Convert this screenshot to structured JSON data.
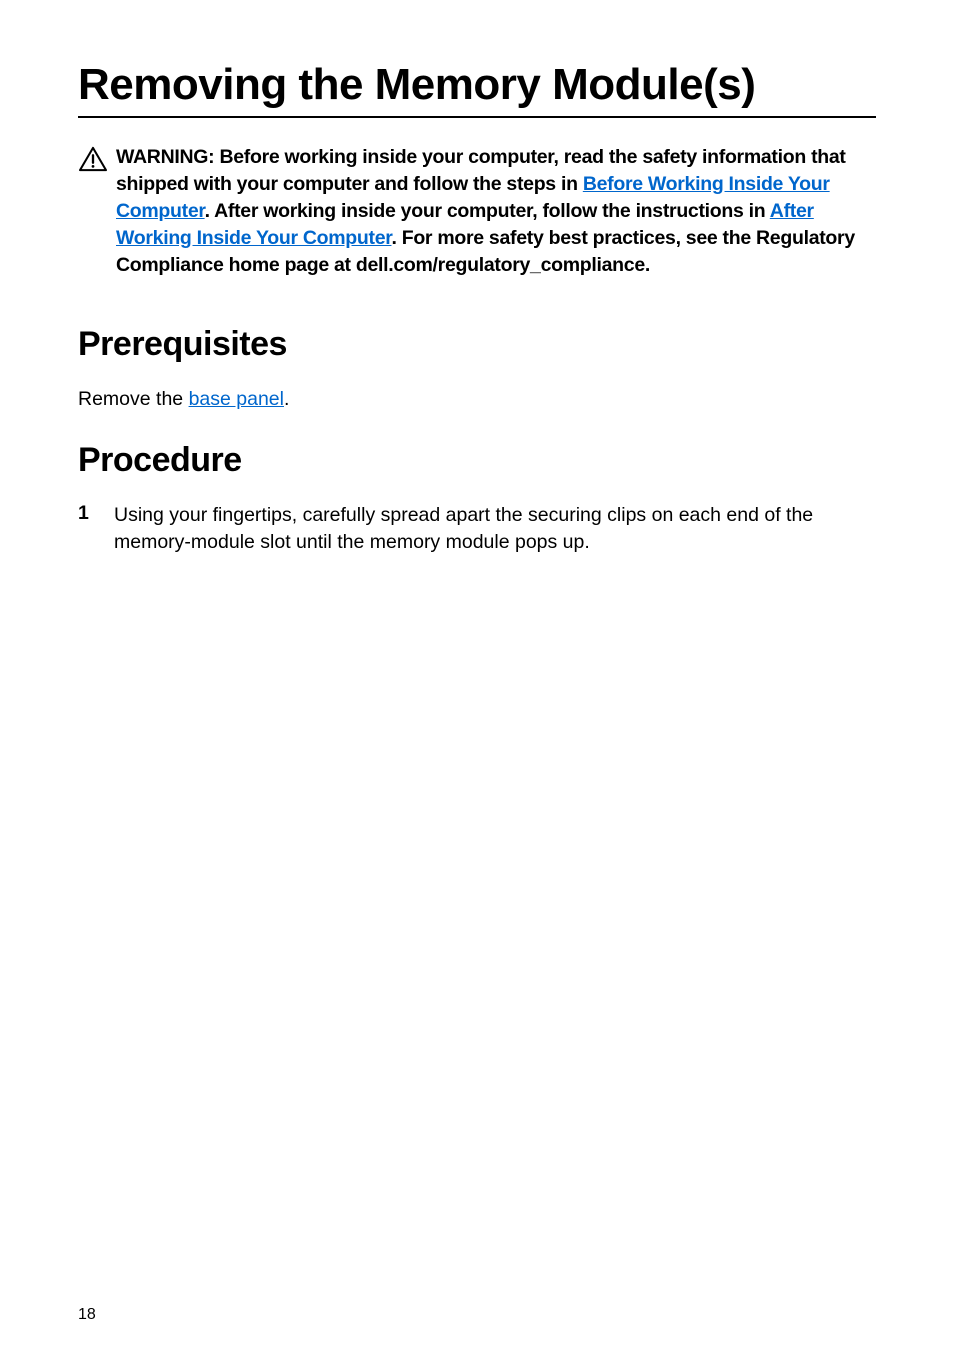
{
  "title": "Removing the Memory Module(s)",
  "warning": {
    "prefix": "WARNING: Before working inside your computer, read the safety information that shipped with your computer and follow the steps in ",
    "link1": "Before Working Inside Your Computer",
    "mid1": ". After working inside your computer, follow the instructions in ",
    "link2": "After Working Inside Your Computer",
    "suffix": ". For more safety best practices, see the Regulatory Compliance home page at dell.com/regulatory_compliance."
  },
  "sections": {
    "prerequisites": {
      "heading": "Prerequisites",
      "text_prefix": "Remove the ",
      "link": "base panel",
      "text_suffix": "."
    },
    "procedure": {
      "heading": "Procedure",
      "steps": [
        {
          "num": "1",
          "text": "Using your fingertips, carefully spread apart the securing clips on each end of the memory-module slot until the memory module pops up."
        }
      ]
    }
  },
  "page_number": "18"
}
